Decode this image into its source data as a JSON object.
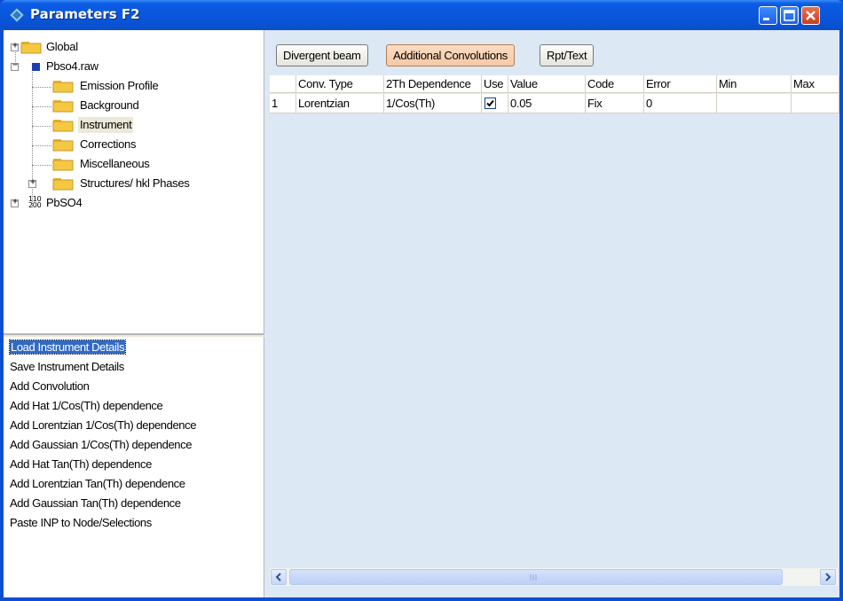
{
  "window": {
    "title": "Parameters F2"
  },
  "tree": {
    "items": [
      {
        "label": "Global"
      },
      {
        "label": "Pbso4.raw"
      },
      {
        "label": "Emission Profile"
      },
      {
        "label": "Background"
      },
      {
        "label": "Instrument"
      },
      {
        "label": "Corrections"
      },
      {
        "label": "Miscellaneous"
      },
      {
        "label": "Structures/ hkl Phases"
      },
      {
        "label": "PbSO4"
      }
    ],
    "hkl_icon_top": "110",
    "hkl_icon_bottom": "200"
  },
  "actions": {
    "items": [
      {
        "label": "Load Instrument Details"
      },
      {
        "label": "Save Instrument Details"
      },
      {
        "label": "Add Convolution"
      },
      {
        "label": "Add Hat 1/Cos(Th) dependence"
      },
      {
        "label": "Add Lorentzian 1/Cos(Th) dependence"
      },
      {
        "label": "Add Gaussian 1/Cos(Th) dependence"
      },
      {
        "label": "Add Hat Tan(Th) dependence"
      },
      {
        "label": "Add Lorentzian Tan(Th) dependence"
      },
      {
        "label": "Add Gaussian Tan(Th) dependence"
      },
      {
        "label": "Paste INP to Node/Selections"
      }
    ]
  },
  "toolbar": {
    "divergent_beam": "Divergent beam",
    "additional_convolutions": "Additional Convolutions",
    "rpt_text": "Rpt/Text"
  },
  "grid": {
    "columns": [
      "Conv. Type",
      "2Th Dependence",
      "Use",
      "Value",
      "Code",
      "Error",
      "Min",
      "Max"
    ],
    "rows": [
      {
        "index": "1",
        "conv_type": "Lorentzian",
        "dependence": "1/Cos(Th)",
        "use": true,
        "value": "0.05",
        "code": "Fix",
        "error": "0",
        "min": "",
        "max": ""
      }
    ]
  },
  "colors": {
    "title_bar": "#0a55db",
    "selection": "#316ac5",
    "active_tab": "#f5c9a5",
    "grid_background": "#dde8f5",
    "folder": "#f0c040"
  }
}
